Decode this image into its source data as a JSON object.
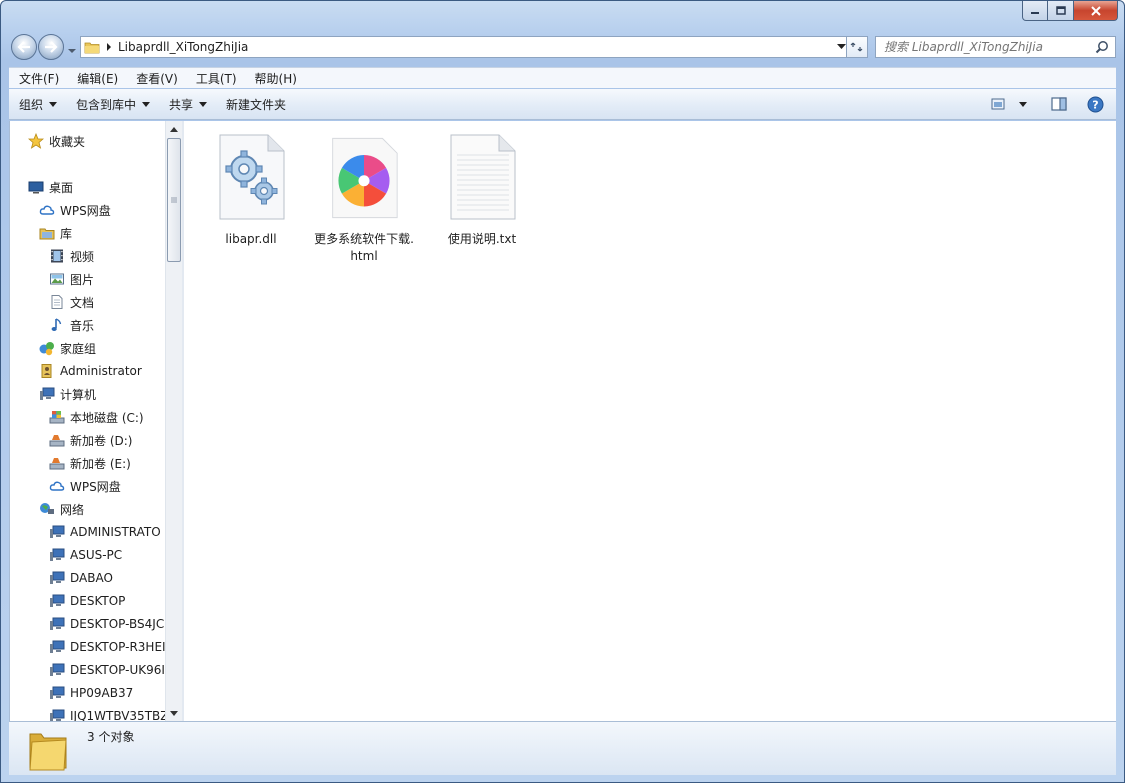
{
  "window": {
    "path": "Libaprdll_XiTongZhiJia",
    "search_placeholder": "搜索 Libaprdll_XiTongZhiJia"
  },
  "menu": [
    "文件(F)",
    "编辑(E)",
    "查看(V)",
    "工具(T)",
    "帮助(H)"
  ],
  "toolbar": {
    "organize": "组织",
    "include_library": "包含到库中",
    "share": "共享",
    "new_folder": "新建文件夹"
  },
  "nav": {
    "favorites": "收藏夹",
    "desktop": "桌面",
    "wps_cloud": "WPS网盘",
    "libraries": "库",
    "videos": "视频",
    "pictures": "图片",
    "documents": "文档",
    "music": "音乐",
    "homegroup": "家庭组",
    "admin": "Administrator",
    "computer": "计算机",
    "drive_c": "本地磁盘 (C:)",
    "drive_d": "新加卷 (D:)",
    "drive_e": "新加卷 (E:)",
    "wps_cloud2": "WPS网盘",
    "network": "网络",
    "net_items": [
      "ADMINISTRATO",
      "ASUS-PC",
      "DABAO",
      "DESKTOP",
      "DESKTOP-BS4JC",
      "DESKTOP-R3HEI",
      "DESKTOP-UK96I",
      "HP09AB37",
      "IJQ1WTBV35TBZ"
    ]
  },
  "files": [
    {
      "name": "libapr.dll",
      "icon": "gears-dll-icon"
    },
    {
      "name": "更多系统软件下载.html",
      "icon": "pinwheel-browser-icon"
    },
    {
      "name": "使用说明.txt",
      "icon": "text-document-icon"
    }
  ],
  "status": {
    "count": "3 个对象"
  }
}
